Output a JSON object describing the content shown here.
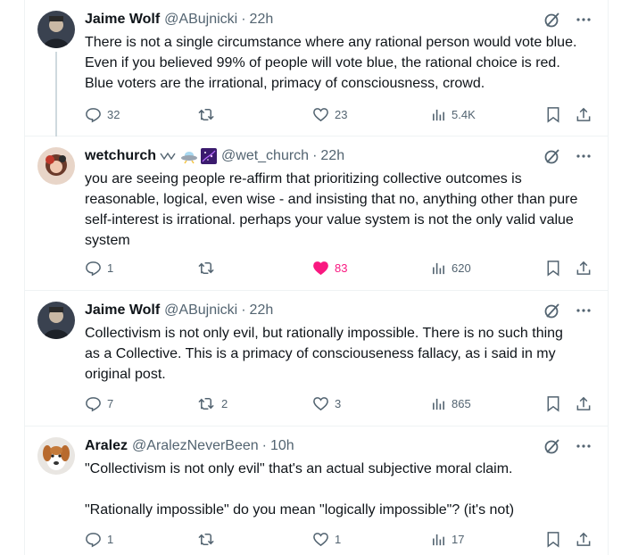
{
  "tweets": [
    {
      "name": "Jaime Wolf",
      "handle": "@ABujnicki",
      "time": "22h",
      "text": "There is not a single circumstance where any rational person would vote blue.\nEven if you believed 99% of people will vote blue, the rational choice is red.\nBlue voters are the irrational, primacy of consciousness, crowd.",
      "replies": "32",
      "reposts": "",
      "likes": "23",
      "views": "5.4K"
    },
    {
      "name": "wetchurch",
      "handle": "@wet_church",
      "time": "22h",
      "text": "you are seeing people re-affirm that prioritizing collective outcomes is\nreasonable, logical, even wise - and insisting that no, anything other than pure\nself-interest is irrational. perhaps your value system is not the only valid value\nsystem",
      "replies": "1",
      "reposts": "",
      "likes": "83",
      "views": "620"
    },
    {
      "name": "Jaime Wolf",
      "handle": "@ABujnicki",
      "time": "22h",
      "text": "Collectivism is not only evil, but rationally impossible. There is no such thing\nas a Collective. This is a primacy of consciouseness fallacy, as i said in my\noriginal post.",
      "replies": "7",
      "reposts": "2",
      "likes": "3",
      "views": "865"
    },
    {
      "name": "Aralez",
      "handle": "@AralezNeverBeen",
      "time": "10h",
      "text": "\"Collectivism is not only evil\" that's an actual subjective moral claim.\n\n\"Rationally impossible\" do you mean \"logically impossible\"? (it's not)",
      "replies": "1",
      "reposts": "",
      "likes": "1",
      "views": "17"
    }
  ],
  "colors": {
    "like_active": "#f91880",
    "muted": "#536471",
    "text": "#0f1419"
  },
  "icons": [
    "reply-icon",
    "repost-icon",
    "like-icon",
    "views-icon",
    "bookmark-icon",
    "share-icon",
    "grok-icon",
    "more-icon"
  ]
}
